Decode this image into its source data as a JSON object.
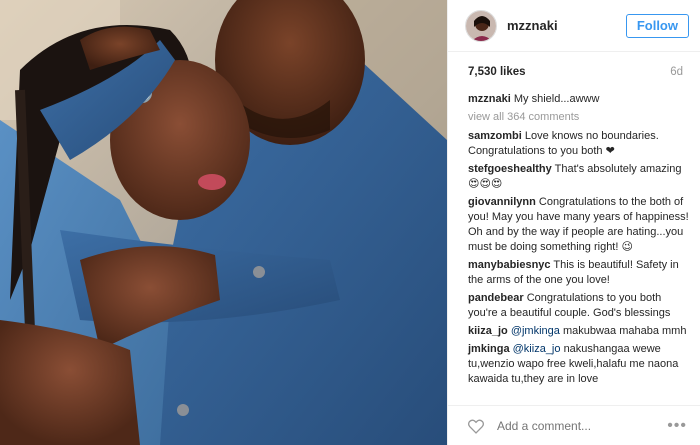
{
  "post": {
    "username": "mzznaki",
    "follow_label": "Follow",
    "likes": "7,530 likes",
    "age": "6d",
    "caption_user": "mzznaki",
    "caption_text": "My shield...awww",
    "view_all": "view all 364 comments",
    "add_comment_placeholder": "Add a comment...",
    "more": "•••"
  },
  "comments": [
    {
      "user": "samzombi",
      "text": "Love knows no boundaries. Congratulations to you both ❤"
    },
    {
      "user": "stefgoeshealthy",
      "text": "That's absolutely amazing 😍😍😍"
    },
    {
      "user": "giovannilynn",
      "text": "Congratulations to the both of you! May you have many years of happiness! Oh and by the way if people are hating...you must be doing something right! 😉"
    },
    {
      "user": "manybabiesnyc",
      "text": "This is beautiful! Safety in the arms of the one you love!"
    },
    {
      "user": "pandebear",
      "text": "Congratulations to you both you're a beautiful couple. God's blessings"
    },
    {
      "user": "kiiza_jo",
      "mention": "@jmkinga",
      "text": "makubwaa mahaba mmh"
    },
    {
      "user": "jmkinga",
      "mention": "@kiiza_jo",
      "text": "nakushangaa wewe tu,wenzio wapo free kweli,halafu me naona kawaida tu,they are in love"
    }
  ],
  "colors": {
    "accent": "#3897f0",
    "muted": "#999999",
    "text": "#262626"
  },
  "icons": {
    "like": "heart-outline-icon",
    "more": "more-options-icon"
  }
}
